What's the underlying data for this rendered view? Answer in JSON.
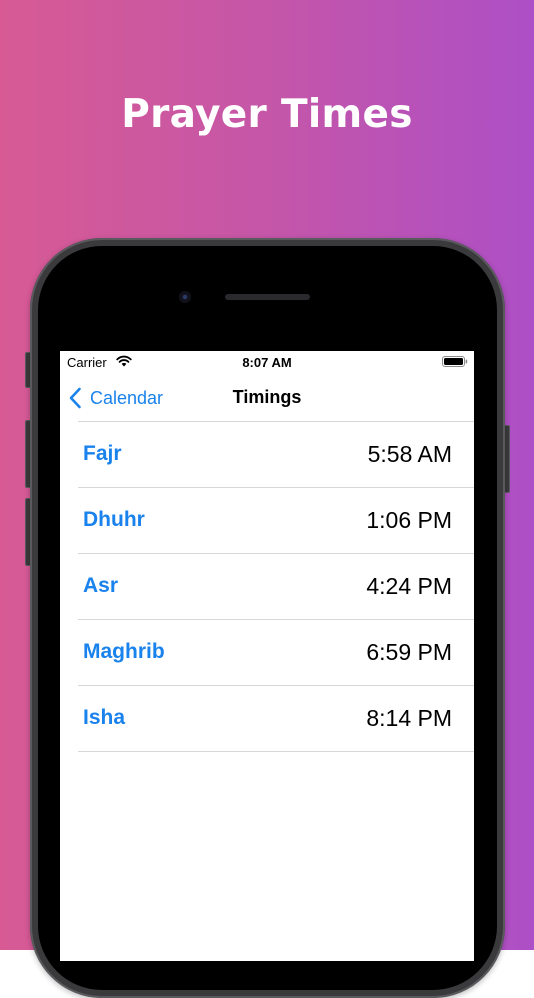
{
  "promo": {
    "headline": "Prayer Times"
  },
  "status_bar": {
    "carrier": "Carrier",
    "time": "8:07 AM",
    "icons": [
      "wifi-icon",
      "battery-icon"
    ]
  },
  "nav_bar": {
    "back_label": "Calendar",
    "back_icon": "chevron-left-icon",
    "title": "Timings"
  },
  "timings": [
    {
      "name": "Fajr",
      "time": "5:58 AM"
    },
    {
      "name": "Dhuhr",
      "time": "1:06 PM"
    },
    {
      "name": "Asr",
      "time": "4:24 PM"
    },
    {
      "name": "Maghrib",
      "time": "6:59 PM"
    },
    {
      "name": "Isha",
      "time": "8:14 PM"
    }
  ],
  "colors": {
    "accent": "#1a82ec",
    "gradient_start": "#d75a94",
    "gradient_end": "#ad4fc6"
  }
}
